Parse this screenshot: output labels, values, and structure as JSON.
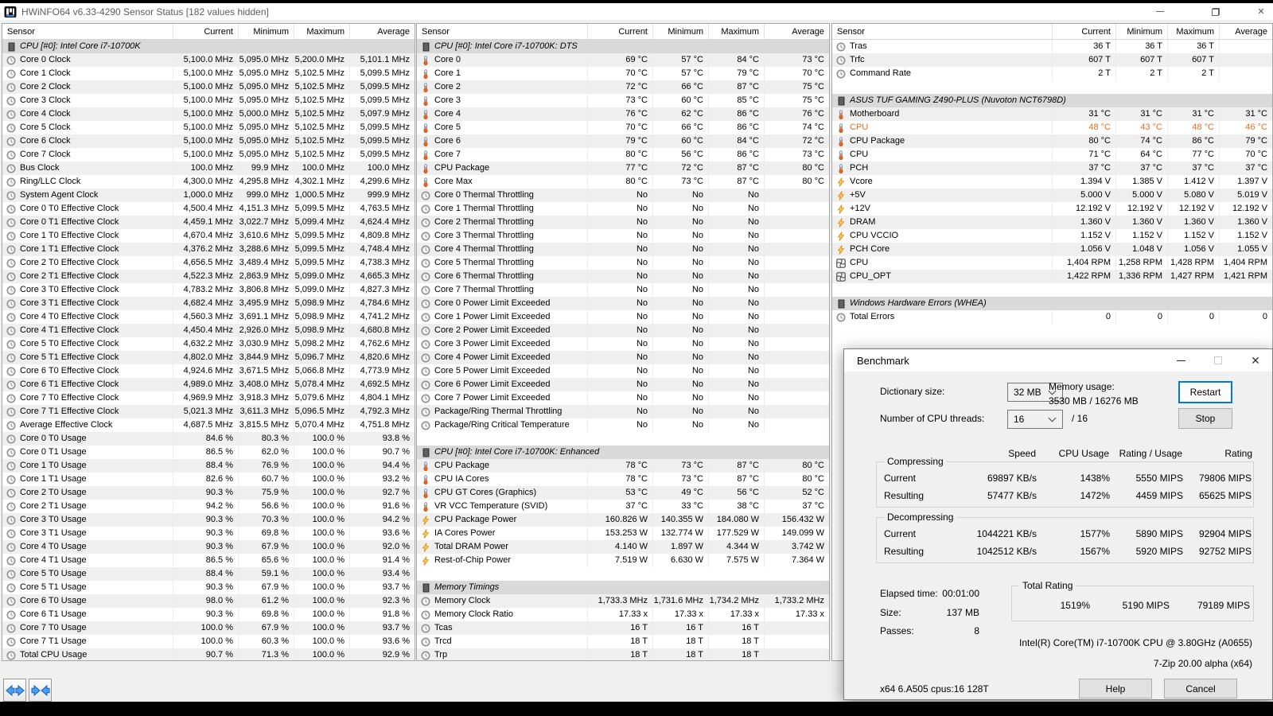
{
  "window": {
    "title": "HWiNFO64 v6.33-4290 Sensor Status [182 values hidden]"
  },
  "columns": [
    "Sensor",
    "Current",
    "Minimum",
    "Maximum",
    "Average"
  ],
  "panels": [
    {
      "rows": [
        [
          "section",
          "CPU [#0]: Intel Core i7-10700K",
          "",
          "",
          "",
          ""
        ],
        [
          "clock",
          "Core 0 Clock",
          "5,100.0 MHz",
          "5,095.0 MHz",
          "5,200.0 MHz",
          "5,101.1 MHz"
        ],
        [
          "clock",
          "Core 1 Clock",
          "5,100.0 MHz",
          "5,095.0 MHz",
          "5,102.5 MHz",
          "5,099.5 MHz"
        ],
        [
          "clock",
          "Core 2 Clock",
          "5,100.0 MHz",
          "5,095.0 MHz",
          "5,102.5 MHz",
          "5,099.5 MHz"
        ],
        [
          "clock",
          "Core 3 Clock",
          "5,100.0 MHz",
          "5,095.0 MHz",
          "5,102.5 MHz",
          "5,099.5 MHz"
        ],
        [
          "clock",
          "Core 4 Clock",
          "5,100.0 MHz",
          "5,000.0 MHz",
          "5,102.5 MHz",
          "5,097.9 MHz"
        ],
        [
          "clock",
          "Core 5 Clock",
          "5,100.0 MHz",
          "5,095.0 MHz",
          "5,102.5 MHz",
          "5,099.5 MHz"
        ],
        [
          "clock",
          "Core 6 Clock",
          "5,100.0 MHz",
          "5,095.0 MHz",
          "5,102.5 MHz",
          "5,099.5 MHz"
        ],
        [
          "clock",
          "Core 7 Clock",
          "5,100.0 MHz",
          "5,095.0 MHz",
          "5,102.5 MHz",
          "5,099.5 MHz"
        ],
        [
          "clock",
          "Bus Clock",
          "100.0 MHz",
          "99.9 MHz",
          "100.0 MHz",
          "100.0 MHz"
        ],
        [
          "clock",
          "Ring/LLC Clock",
          "4,300.0 MHz",
          "4,295.8 MHz",
          "4,302.1 MHz",
          "4,299.6 MHz"
        ],
        [
          "clock",
          "System Agent Clock",
          "1,000.0 MHz",
          "999.0 MHz",
          "1,000.5 MHz",
          "999.9 MHz"
        ],
        [
          "clock",
          "Core 0 T0 Effective Clock",
          "4,500.4 MHz",
          "4,151.3 MHz",
          "5,099.5 MHz",
          "4,763.5 MHz"
        ],
        [
          "clock",
          "Core 0 T1 Effective Clock",
          "4,459.1 MHz",
          "3,022.7 MHz",
          "5,099.4 MHz",
          "4,624.4 MHz"
        ],
        [
          "clock",
          "Core 1 T0 Effective Clock",
          "4,670.4 MHz",
          "3,610.6 MHz",
          "5,099.5 MHz",
          "4,809.8 MHz"
        ],
        [
          "clock",
          "Core 1 T1 Effective Clock",
          "4,376.2 MHz",
          "3,288.6 MHz",
          "5,099.5 MHz",
          "4,748.4 MHz"
        ],
        [
          "clock",
          "Core 2 T0 Effective Clock",
          "4,656.5 MHz",
          "3,489.4 MHz",
          "5,099.5 MHz",
          "4,738.3 MHz"
        ],
        [
          "clock",
          "Core 2 T1 Effective Clock",
          "4,522.3 MHz",
          "2,863.9 MHz",
          "5,099.0 MHz",
          "4,665.3 MHz"
        ],
        [
          "clock",
          "Core 3 T0 Effective Clock",
          "4,783.2 MHz",
          "3,806.8 MHz",
          "5,099.0 MHz",
          "4,827.3 MHz"
        ],
        [
          "clock",
          "Core 3 T1 Effective Clock",
          "4,682.4 MHz",
          "3,495.9 MHz",
          "5,098.9 MHz",
          "4,784.6 MHz"
        ],
        [
          "clock",
          "Core 4 T0 Effective Clock",
          "4,560.3 MHz",
          "3,691.1 MHz",
          "5,098.9 MHz",
          "4,741.2 MHz"
        ],
        [
          "clock",
          "Core 4 T1 Effective Clock",
          "4,450.4 MHz",
          "2,926.0 MHz",
          "5,098.9 MHz",
          "4,680.8 MHz"
        ],
        [
          "clock",
          "Core 5 T0 Effective Clock",
          "4,632.2 MHz",
          "3,030.9 MHz",
          "5,098.2 MHz",
          "4,762.6 MHz"
        ],
        [
          "clock",
          "Core 5 T1 Effective Clock",
          "4,802.0 MHz",
          "3,844.9 MHz",
          "5,096.7 MHz",
          "4,820.6 MHz"
        ],
        [
          "clock",
          "Core 6 T0 Effective Clock",
          "4,924.6 MHz",
          "3,671.5 MHz",
          "5,066.8 MHz",
          "4,773.9 MHz"
        ],
        [
          "clock",
          "Core 6 T1 Effective Clock",
          "4,989.0 MHz",
          "3,408.0 MHz",
          "5,078.4 MHz",
          "4,692.5 MHz"
        ],
        [
          "clock",
          "Core 7 T0 Effective Clock",
          "4,969.9 MHz",
          "3,918.3 MHz",
          "5,079.6 MHz",
          "4,804.1 MHz"
        ],
        [
          "clock",
          "Core 7 T1 Effective Clock",
          "5,021.3 MHz",
          "3,611.3 MHz",
          "5,096.5 MHz",
          "4,792.3 MHz"
        ],
        [
          "clock",
          "Average Effective Clock",
          "4,687.5 MHz",
          "3,815.5 MHz",
          "5,070.4 MHz",
          "4,751.8 MHz"
        ],
        [
          "clock",
          "Core 0 T0 Usage",
          "84.6 %",
          "80.3 %",
          "100.0 %",
          "93.8 %"
        ],
        [
          "clock",
          "Core 0 T1 Usage",
          "86.5 %",
          "62.0 %",
          "100.0 %",
          "90.7 %"
        ],
        [
          "clock",
          "Core 1 T0 Usage",
          "88.4 %",
          "76.9 %",
          "100.0 %",
          "94.4 %"
        ],
        [
          "clock",
          "Core 1 T1 Usage",
          "82.6 %",
          "60.7 %",
          "100.0 %",
          "93.2 %"
        ],
        [
          "clock",
          "Core 2 T0 Usage",
          "90.3 %",
          "75.9 %",
          "100.0 %",
          "92.7 %"
        ],
        [
          "clock",
          "Core 2 T1 Usage",
          "94.2 %",
          "56.6 %",
          "100.0 %",
          "91.6 %"
        ],
        [
          "clock",
          "Core 3 T0 Usage",
          "90.3 %",
          "70.3 %",
          "100.0 %",
          "94.2 %"
        ],
        [
          "clock",
          "Core 3 T1 Usage",
          "90.3 %",
          "69.8 %",
          "100.0 %",
          "93.6 %"
        ],
        [
          "clock",
          "Core 4 T0 Usage",
          "90.3 %",
          "67.9 %",
          "100.0 %",
          "92.0 %"
        ],
        [
          "clock",
          "Core 4 T1 Usage",
          "86.5 %",
          "65.6 %",
          "100.0 %",
          "91.4 %"
        ],
        [
          "clock",
          "Core 5 T0 Usage",
          "88.4 %",
          "59.1 %",
          "100.0 %",
          "93.4 %"
        ],
        [
          "clock",
          "Core 5 T1 Usage",
          "90.3 %",
          "67.9 %",
          "100.0 %",
          "93.7 %"
        ],
        [
          "clock",
          "Core 6 T0 Usage",
          "98.0 %",
          "61.2 %",
          "100.0 %",
          "92.3 %"
        ],
        [
          "clock",
          "Core 6 T1 Usage",
          "90.3 %",
          "69.8 %",
          "100.0 %",
          "91.8 %"
        ],
        [
          "clock",
          "Core 7 T0 Usage",
          "100.0 %",
          "67.9 %",
          "100.0 %",
          "93.7 %"
        ],
        [
          "clock",
          "Core 7 T1 Usage",
          "100.0 %",
          "60.3 %",
          "100.0 %",
          "93.6 %"
        ],
        [
          "clock",
          "Total CPU Usage",
          "90.7 %",
          "71.3 %",
          "100.0 %",
          "92.9 %"
        ]
      ]
    },
    {
      "rows": [
        [
          "section",
          "CPU [#0]: Intel Core i7-10700K: DTS",
          "",
          "",
          "",
          ""
        ],
        [
          "temp",
          "Core 0",
          "69 °C",
          "57 °C",
          "84 °C",
          "73 °C"
        ],
        [
          "temp",
          "Core 1",
          "70 °C",
          "57 °C",
          "79 °C",
          "70 °C"
        ],
        [
          "temp",
          "Core 2",
          "72 °C",
          "66 °C",
          "87 °C",
          "75 °C"
        ],
        [
          "temp",
          "Core 3",
          "73 °C",
          "60 °C",
          "85 °C",
          "75 °C"
        ],
        [
          "temp",
          "Core 4",
          "76 °C",
          "62 °C",
          "86 °C",
          "76 °C"
        ],
        [
          "temp",
          "Core 5",
          "70 °C",
          "66 °C",
          "86 °C",
          "74 °C"
        ],
        [
          "temp",
          "Core 6",
          "79 °C",
          "60 °C",
          "84 °C",
          "72 °C"
        ],
        [
          "temp",
          "Core 7",
          "80 °C",
          "56 °C",
          "86 °C",
          "73 °C"
        ],
        [
          "temp",
          "CPU Package",
          "77 °C",
          "72 °C",
          "87 °C",
          "80 °C"
        ],
        [
          "temp",
          "Core Max",
          "80 °C",
          "73 °C",
          "87 °C",
          "80 °C"
        ],
        [
          "clock",
          "Core 0 Thermal Throttling",
          "No",
          "No",
          "No",
          ""
        ],
        [
          "clock",
          "Core 1 Thermal Throttling",
          "No",
          "No",
          "No",
          ""
        ],
        [
          "clock",
          "Core 2 Thermal Throttling",
          "No",
          "No",
          "No",
          ""
        ],
        [
          "clock",
          "Core 3 Thermal Throttling",
          "No",
          "No",
          "No",
          ""
        ],
        [
          "clock",
          "Core 4 Thermal Throttling",
          "No",
          "No",
          "No",
          ""
        ],
        [
          "clock",
          "Core 5 Thermal Throttling",
          "No",
          "No",
          "No",
          ""
        ],
        [
          "clock",
          "Core 6 Thermal Throttling",
          "No",
          "No",
          "No",
          ""
        ],
        [
          "clock",
          "Core 7 Thermal Throttling",
          "No",
          "No",
          "No",
          ""
        ],
        [
          "clock",
          "Core 0 Power Limit Exceeded",
          "No",
          "No",
          "No",
          ""
        ],
        [
          "clock",
          "Core 1 Power Limit Exceeded",
          "No",
          "No",
          "No",
          ""
        ],
        [
          "clock",
          "Core 2 Power Limit Exceeded",
          "No",
          "No",
          "No",
          ""
        ],
        [
          "clock",
          "Core 3 Power Limit Exceeded",
          "No",
          "No",
          "No",
          ""
        ],
        [
          "clock",
          "Core 4 Power Limit Exceeded",
          "No",
          "No",
          "No",
          ""
        ],
        [
          "clock",
          "Core 5 Power Limit Exceeded",
          "No",
          "No",
          "No",
          ""
        ],
        [
          "clock",
          "Core 6 Power Limit Exceeded",
          "No",
          "No",
          "No",
          ""
        ],
        [
          "clock",
          "Core 7 Power Limit Exceeded",
          "No",
          "No",
          "No",
          ""
        ],
        [
          "clock",
          "Package/Ring Thermal Throttling",
          "No",
          "No",
          "No",
          ""
        ],
        [
          "clock",
          "Package/Ring Critical Temperature",
          "No",
          "No",
          "No",
          ""
        ],
        [
          "gap",
          "",
          "",
          "",
          "",
          ""
        ],
        [
          "section",
          "CPU [#0]: Intel Core i7-10700K: Enhanced",
          "",
          "",
          "",
          ""
        ],
        [
          "temp",
          "CPU Package",
          "78 °C",
          "73 °C",
          "87 °C",
          "80 °C"
        ],
        [
          "temp",
          "CPU IA Cores",
          "78 °C",
          "73 °C",
          "87 °C",
          "80 °C"
        ],
        [
          "temp",
          "CPU GT Cores (Graphics)",
          "53 °C",
          "49 °C",
          "56 °C",
          "52 °C"
        ],
        [
          "temp",
          "VR VCC Temperature (SVID)",
          "37 °C",
          "33 °C",
          "38 °C",
          "37 °C"
        ],
        [
          "volt",
          "CPU Package Power",
          "160.826 W",
          "140.355 W",
          "184.080 W",
          "156.432 W"
        ],
        [
          "volt",
          "IA Cores Power",
          "153.253 W",
          "132.774 W",
          "177.529 W",
          "149.099 W"
        ],
        [
          "volt",
          "Total DRAM Power",
          "4.140 W",
          "1.897 W",
          "4.344 W",
          "3.742 W"
        ],
        [
          "volt",
          "Rest-of-Chip Power",
          "7.519 W",
          "6.630 W",
          "7.575 W",
          "7.364 W"
        ],
        [
          "gap",
          "",
          "",
          "",
          "",
          ""
        ],
        [
          "section",
          "Memory Timings",
          "",
          "",
          "",
          ""
        ],
        [
          "clock",
          "Memory Clock",
          "1,733.3 MHz",
          "1,731.6 MHz",
          "1,734.2 MHz",
          "1,733.2 MHz"
        ],
        [
          "clock",
          "Memory Clock Ratio",
          "17.33 x",
          "17.33 x",
          "17.33 x",
          "17.33 x"
        ],
        [
          "clock",
          "Tcas",
          "16 T",
          "16 T",
          "16 T",
          ""
        ],
        [
          "clock",
          "Trcd",
          "18 T",
          "18 T",
          "18 T",
          ""
        ],
        [
          "clock",
          "Trp",
          "18 T",
          "18 T",
          "18 T",
          ""
        ]
      ]
    },
    {
      "rows": [
        [
          "clock",
          "Tras",
          "36 T",
          "36 T",
          "36 T",
          ""
        ],
        [
          "clock",
          "Trfc",
          "607 T",
          "607 T",
          "607 T",
          ""
        ],
        [
          "clock",
          "Command Rate",
          "2 T",
          "2 T",
          "2 T",
          ""
        ],
        [
          "gap",
          "",
          "",
          "",
          "",
          ""
        ],
        [
          "section",
          "ASUS TUF GAMING Z490-PLUS (Nuvoton NCT6798D)",
          "",
          "",
          "",
          ""
        ],
        [
          "temp",
          "Motherboard",
          "31 °C",
          "31 °C",
          "31 °C",
          "31 °C"
        ],
        [
          "temp_hot",
          "CPU",
          "48 °C",
          "43 °C",
          "48 °C",
          "46 °C"
        ],
        [
          "temp",
          "CPU Package",
          "80 °C",
          "74 °C",
          "86 °C",
          "79 °C"
        ],
        [
          "temp",
          "CPU",
          "71 °C",
          "64 °C",
          "77 °C",
          "70 °C"
        ],
        [
          "temp",
          "PCH",
          "37 °C",
          "37 °C",
          "37 °C",
          "37 °C"
        ],
        [
          "volt",
          "Vcore",
          "1.394 V",
          "1.385 V",
          "1.412 V",
          "1.397 V"
        ],
        [
          "volt",
          "+5V",
          "5.000 V",
          "5.000 V",
          "5.080 V",
          "5.019 V"
        ],
        [
          "volt",
          "+12V",
          "12.192 V",
          "12.192 V",
          "12.192 V",
          "12.192 V"
        ],
        [
          "volt",
          "DRAM",
          "1.360 V",
          "1.360 V",
          "1.360 V",
          "1.360 V"
        ],
        [
          "volt",
          "CPU VCCIO",
          "1.152 V",
          "1.152 V",
          "1.152 V",
          "1.152 V"
        ],
        [
          "volt",
          "PCH Core",
          "1.056 V",
          "1.048 V",
          "1.056 V",
          "1.055 V"
        ],
        [
          "fan",
          "CPU",
          "1,404 RPM",
          "1,258 RPM",
          "1,428 RPM",
          "1,404 RPM"
        ],
        [
          "fan",
          "CPU_OPT",
          "1,422 RPM",
          "1,336 RPM",
          "1,427 RPM",
          "1,421 RPM"
        ],
        [
          "gap",
          "",
          "",
          "",
          "",
          ""
        ],
        [
          "section",
          "Windows Hardware Errors (WHEA)",
          "",
          "",
          "",
          ""
        ],
        [
          "clock",
          "Total Errors",
          "0",
          "0",
          "0",
          "0"
        ]
      ]
    }
  ],
  "benchmark": {
    "title": "Benchmark",
    "dictionary_label": "Dictionary size:",
    "dictionary_value": "32 MB",
    "memory_usage_label": "Memory usage:",
    "memory_usage_value": "3530 MB / 16276 MB",
    "threads_label": "Number of CPU threads:",
    "threads_value": "16",
    "threads_suffix": "/ 16",
    "restart_label": "Restart",
    "stop_label": "Stop",
    "result_columns": [
      "Speed",
      "CPU Usage",
      "Rating / Usage",
      "Rating"
    ],
    "compressing": {
      "label": "Compressing",
      "rows": [
        {
          "label": "Current",
          "speed": "69897 KB/s",
          "cpu": "1438%",
          "rating_usage": "5550 MIPS",
          "rating": "79806 MIPS"
        },
        {
          "label": "Resulting",
          "speed": "57477 KB/s",
          "cpu": "1472%",
          "rating_usage": "4459 MIPS",
          "rating": "65625 MIPS"
        }
      ]
    },
    "decompressing": {
      "label": "Decompressing",
      "rows": [
        {
          "label": "Current",
          "speed": "1044221 KB/s",
          "cpu": "1577%",
          "rating_usage": "5890 MIPS",
          "rating": "92904 MIPS"
        },
        {
          "label": "Resulting",
          "speed": "1042512 KB/s",
          "cpu": "1567%",
          "rating_usage": "5920 MIPS",
          "rating": "92752 MIPS"
        }
      ]
    },
    "elapsed_label": "Elapsed time:",
    "elapsed_value": "00:01:00",
    "size_label": "Size:",
    "size_value": "137 MB",
    "passes_label": "Passes:",
    "passes_value": "8",
    "total_rating": {
      "label": "Total Rating",
      "cpu": "1519%",
      "rating_usage": "5190 MIPS",
      "rating": "79189 MIPS"
    },
    "cpu_name": "Intel(R) Core(TM) i7-10700K CPU @ 3.80GHz (A0655)",
    "app_version": "7-Zip 20.00 alpha (x64)",
    "build_info": "x64 6.A505 cpus:16 128T",
    "help_label": "Help",
    "cancel_label": "Cancel"
  }
}
